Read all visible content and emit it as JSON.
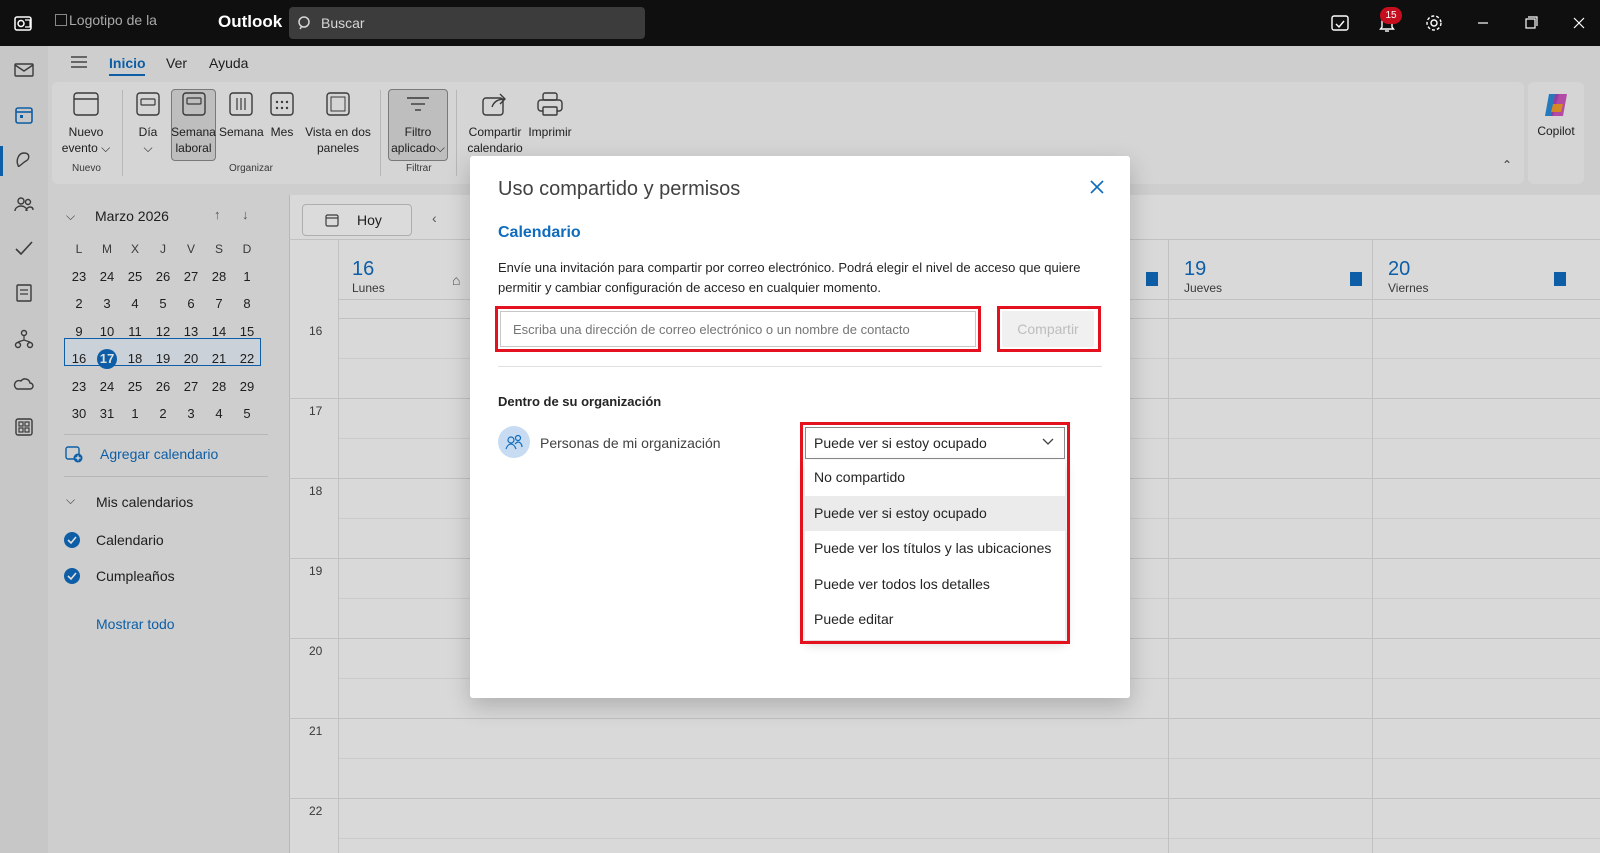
{
  "titlebar": {
    "logo_alt": "Logotipo de la",
    "app_title": "Outlook",
    "search_placeholder": "Buscar",
    "notification_count": "15"
  },
  "ribbon": {
    "tabs": [
      "Inicio",
      "Ver",
      "Ayuda"
    ],
    "buttons": {
      "new_event": [
        "Nuevo",
        "evento"
      ],
      "day": "Día",
      "work_week": [
        "Semana",
        "laboral"
      ],
      "week": "Semana",
      "month": "Mes",
      "split": [
        "Vista en dos",
        "paneles"
      ],
      "filter": [
        "Filtro",
        "aplicado"
      ],
      "share": [
        "Compartir",
        "calendario"
      ],
      "print": "Imprimir"
    },
    "groups": {
      "new": "Nuevo",
      "organize": "Organizar",
      "filter": "Filtrar"
    },
    "copilot": "Copilot"
  },
  "mini_calendar": {
    "month": "Marzo 2026",
    "dow": [
      "L",
      "M",
      "X",
      "J",
      "V",
      "S",
      "D"
    ],
    "weeks": [
      [
        "23",
        "24",
        "25",
        "26",
        "27",
        "28",
        "1"
      ],
      [
        "2",
        "3",
        "4",
        "5",
        "6",
        "7",
        "8"
      ],
      [
        "9",
        "10",
        "11",
        "12",
        "13",
        "14",
        "15"
      ],
      [
        "16",
        "17",
        "18",
        "19",
        "20",
        "21",
        "22"
      ],
      [
        "23",
        "24",
        "25",
        "26",
        "27",
        "28",
        "29"
      ],
      [
        "30",
        "31",
        "1",
        "2",
        "3",
        "4",
        "5"
      ]
    ],
    "today": "17"
  },
  "left_panel": {
    "add_calendar": "Agregar calendario",
    "my_calendars": "Mis calendarios",
    "calendars": [
      "Calendario",
      "Cumpleaños"
    ],
    "show_all": "Mostrar todo"
  },
  "calendar": {
    "today_button": "Hoy",
    "days": [
      {
        "num": "16",
        "name": "Lunes"
      },
      {
        "num": "19",
        "name": "Jueves"
      },
      {
        "num": "20",
        "name": "Viernes"
      }
    ],
    "hours": [
      "16",
      "17",
      "18",
      "19",
      "20",
      "21",
      "22"
    ]
  },
  "dialog": {
    "title": "Uso compartido y permisos",
    "calendar_name": "Calendario",
    "description": "Envíe una invitación para compartir por correo electrónico. Podrá elegir el nivel de acceso que quiere permitir y cambiar configuración de acceso en cualquier momento.",
    "input_placeholder": "Escriba una dirección de correo electrónico o un nombre de contacto",
    "share_button": "Compartir",
    "section_title": "Dentro de su organización",
    "person_label": "Personas de mi organización",
    "selected_permission": "Puede ver si estoy ocupado",
    "permission_options": [
      "No compartido",
      "Puede ver si estoy ocupado",
      "Puede ver los títulos y las ubicaciones",
      "Puede ver todos los detalles",
      "Puede editar"
    ]
  },
  "colors": {
    "accent": "#0f6cbd",
    "highlight_box": "#e3121e",
    "titlebar": "#0f0f0f"
  }
}
